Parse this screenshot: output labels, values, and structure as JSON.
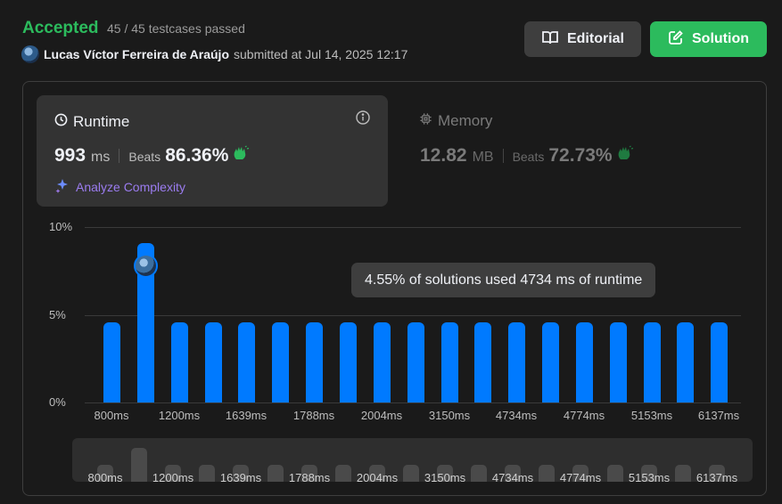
{
  "header": {
    "status": "Accepted",
    "testcases": "45 / 45 testcases passed",
    "username": "Lucas Víctor Ferreira de Araújo",
    "submitted": "submitted at Jul 14, 2025 12:17"
  },
  "buttons": {
    "editorial": "Editorial",
    "solution": "Solution"
  },
  "runtime": {
    "title": "Runtime",
    "value": "993",
    "unit": "ms",
    "beats_label": "Beats",
    "beats_value": "86.36%",
    "analyze": "Analyze Complexity"
  },
  "memory": {
    "title": "Memory",
    "value": "12.82",
    "unit": "MB",
    "beats_label": "Beats",
    "beats_value": "72.73%"
  },
  "tooltip": "4.55% of solutions used 4734 ms of runtime",
  "colors": {
    "accent_green": "#2cbb5d",
    "bar_blue": "#007aff",
    "analyze_purple": "#9b7cf0"
  },
  "chart_data": {
    "type": "bar",
    "ylabel_ticks": [
      "10%",
      "5%",
      "0%"
    ],
    "ylim": [
      0,
      10
    ],
    "values": [
      4.55,
      9.09,
      4.55,
      4.55,
      4.55,
      4.55,
      4.55,
      4.55,
      4.55,
      4.55,
      4.55,
      4.55,
      4.55,
      4.55,
      4.55,
      4.55,
      4.55,
      4.55,
      4.55
    ],
    "x_tick_labels": [
      "800ms",
      "1200ms",
      "1639ms",
      "1788ms",
      "2004ms",
      "3150ms",
      "4734ms",
      "4774ms",
      "5153ms",
      "6137ms"
    ],
    "highlighted_index": 1,
    "mini_values": [
      4.55,
      9.09,
      4.55,
      4.55,
      4.55,
      4.55,
      4.55,
      4.55,
      4.55,
      4.55,
      4.55,
      4.55,
      4.55,
      4.55,
      4.55,
      4.55,
      4.55,
      4.55,
      4.55
    ],
    "mini_tick_labels": [
      "800ms",
      "1200ms",
      "1639ms",
      "1788ms",
      "2004ms",
      "3150ms",
      "4734ms",
      "4774ms",
      "5153ms",
      "6137ms"
    ]
  }
}
